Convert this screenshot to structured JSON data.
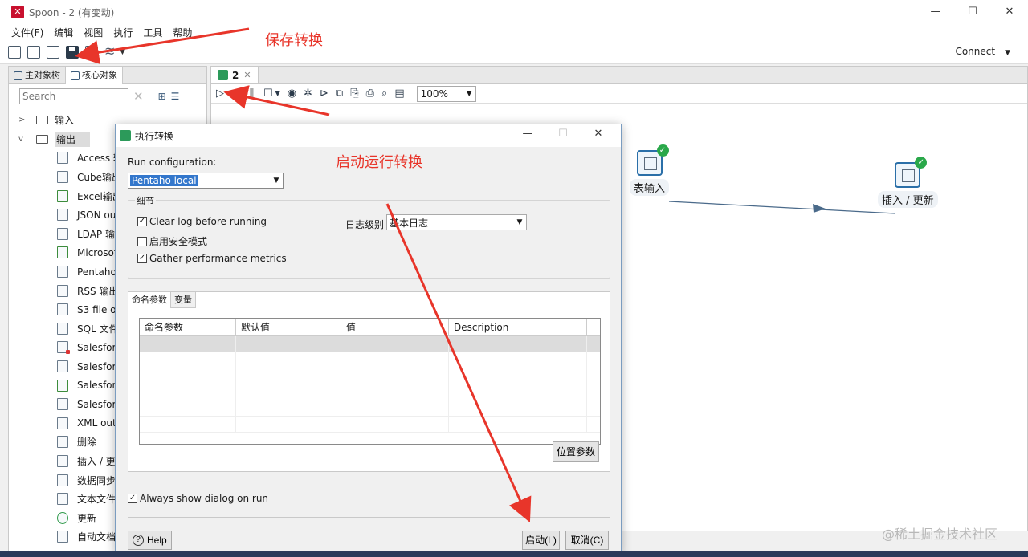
{
  "window": {
    "title": "Spoon - 2 (有变动)",
    "app_icon": "pentaho-icon"
  },
  "menu": [
    "文件(F)",
    "编辑",
    "视图",
    "执行",
    "工具",
    "帮助"
  ],
  "toolbar": {
    "connect_label": "Connect"
  },
  "left_panel": {
    "tabs": [
      "主对象树",
      "核心对象"
    ],
    "search_placeholder": "Search",
    "folders": [
      {
        "label": "输入",
        "expanded": false
      },
      {
        "label": "输出",
        "expanded": true
      }
    ],
    "items": [
      "Access 输",
      "Cube输出",
      "Excel输出",
      "JSON ou",
      "LDAP 输",
      "Microsof",
      "Pentaho",
      "RSS 输出",
      "S3 file ou",
      "SQL 文件",
      "Salesforc",
      "Salesforc",
      "Salesforc",
      "Salesforc",
      "XML out",
      "删除",
      "插入 / 更",
      "数据同步",
      "文本文件",
      "更新",
      "自动文档"
    ]
  },
  "editor": {
    "tab_label": "2",
    "zoom": "100%",
    "steps": [
      {
        "label": "表输入"
      },
      {
        "label": "插入 / 更新"
      }
    ]
  },
  "dialog": {
    "title": "执行转换",
    "run_config_label": "Run configuration:",
    "run_config_value": "Pentaho local",
    "group_label": "细节",
    "options": [
      {
        "label": "Clear log before running",
        "checked": true
      },
      {
        "label": "启用安全模式",
        "checked": false
      },
      {
        "label": "Gather performance metrics",
        "checked": true
      }
    ],
    "log_level_label": "日志级别",
    "log_level_value": "基本日志",
    "tabs": [
      "命名参数",
      "变量"
    ],
    "columns": [
      "命名参数",
      "默认值",
      "值",
      "Description"
    ],
    "position_params_button": "位置参数",
    "always_show": {
      "label": "Always show dialog on run",
      "checked": true
    },
    "help_button": "Help",
    "ok_button": "启动(L)",
    "cancel_button": "取消(C)"
  },
  "annotations": {
    "save": "保存转换",
    "run": "启动运行转换"
  },
  "watermark": "@稀土掘金技术社区",
  "colors": {
    "annotation": "#e8352a",
    "accent": "#3377cc",
    "step_border": "#2a6fa8",
    "check": "#2aa84a"
  }
}
